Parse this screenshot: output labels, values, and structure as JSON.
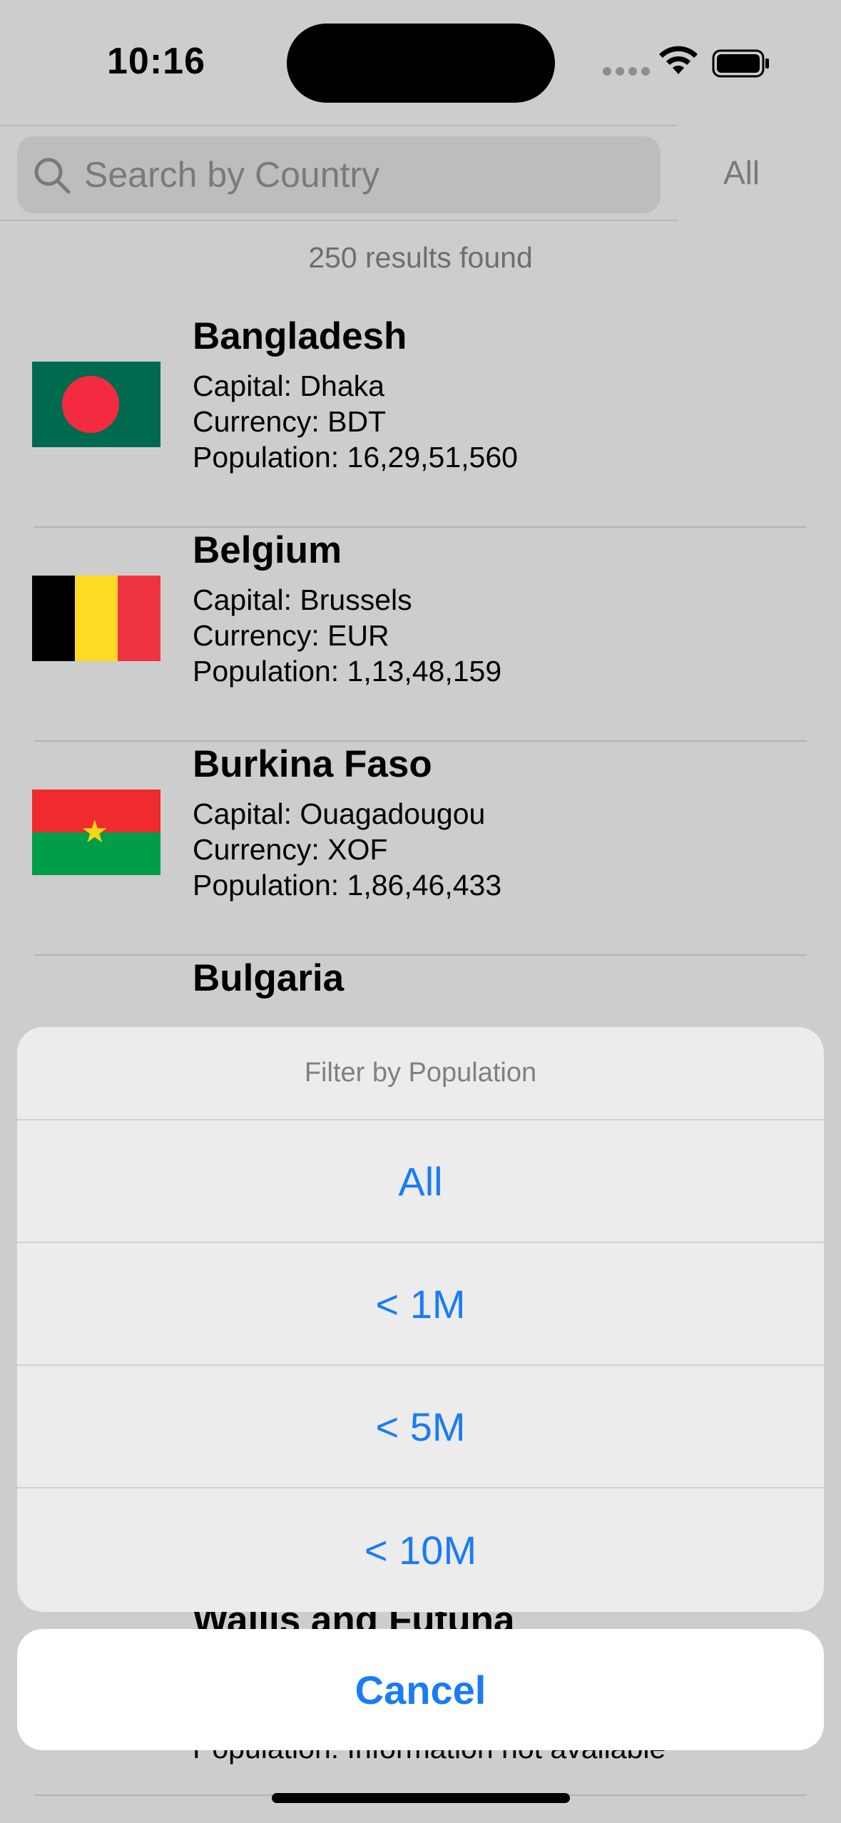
{
  "status_bar": {
    "time": "10:16"
  },
  "search": {
    "placeholder": "Search by Country",
    "value": ""
  },
  "filter_button_label": "All",
  "results_count": "250 results found",
  "countries": [
    {
      "name": "Bangladesh",
      "capital": "Capital: Dhaka",
      "currency": "Currency: BDT",
      "population": "Population: 16,29,51,560"
    },
    {
      "name": "Belgium",
      "capital": "Capital: Brussels",
      "currency": "Currency: EUR",
      "population": "Population: 1,13,48,159"
    },
    {
      "name": "Burkina Faso",
      "capital": "Capital: Ouagadougou",
      "currency": "Currency: XOF",
      "population": "Population: 1,86,46,433"
    },
    {
      "name": "Bulgaria"
    }
  ],
  "peek": {
    "name": "Wallis and Futuna",
    "population": "Population: Information not available"
  },
  "action_sheet": {
    "title": "Filter by Population",
    "options": [
      "All",
      "< 1M",
      "< 5M",
      "< 10M"
    ],
    "cancel_label": "Cancel"
  },
  "colors": {
    "accent": "#1a7cf4",
    "bangladesh_green": "#006a4e",
    "bangladesh_red": "#f42a41",
    "belgium_black": "#000000",
    "belgium_yellow": "#fdda24",
    "belgium_red": "#ef3340",
    "burkina_red": "#ef2b2d",
    "burkina_green": "#009e49",
    "burkina_star": "#fcd116"
  }
}
